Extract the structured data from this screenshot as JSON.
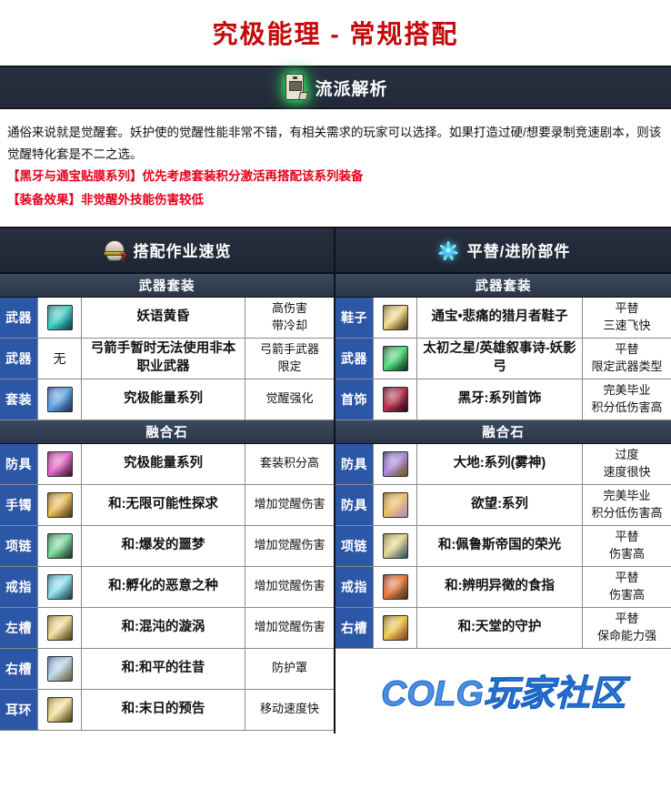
{
  "page": {
    "title": "究极能理 - 常规搭配",
    "title_color": "#c20a0a",
    "watermark": "COLG玩家社区",
    "footer_logo": "COLG玩家社区"
  },
  "analysis_section": {
    "icon": "scroll-document-icon",
    "header_label": "流派解析",
    "paragraph": "通俗来说就是觉醒套。妖护使的觉醒性能非常不错，有相关需求的玩家可以选择。如果打造过硬/想要录制竞速剧本，则该觉醒特化套是不二之选。",
    "notes": [
      "【黑牙与通宝贴膜系列】优先考虑套装积分激活再搭配该系列装备",
      "【装备效果】非觉醒外技能伤害较低"
    ],
    "note_color": "#e4001b"
  },
  "left_panel": {
    "icon": "helmet-question-icon",
    "header_label": "搭配作业速览",
    "groups": [
      {
        "group_label": "武器套装",
        "rows": [
          {
            "slot": "武器",
            "icon": "item-icon-weapon-teal",
            "icon_text": "",
            "name": "妖语黄昏",
            "note": "高伤害\n带冷却"
          },
          {
            "slot": "武器",
            "icon": "",
            "icon_text": "无",
            "name": "弓箭手暂时无法使用非本职业武器",
            "note": "弓箭手武器\n限定"
          },
          {
            "slot": "套装",
            "icon": "item-icon-armor-blue",
            "icon_text": "",
            "name": "究极能量系列",
            "note": "觉醒强化"
          }
        ]
      },
      {
        "group_label": "融合石",
        "rows": [
          {
            "slot": "防具",
            "icon": "item-icon-pink-orb",
            "icon_text": "",
            "name": "究极能量系列",
            "note": "套装积分高"
          },
          {
            "slot": "手镯",
            "icon": "item-icon-gold-hand",
            "icon_text": "",
            "name": "和:无限可能性探求",
            "note": "增加觉醒伤害"
          },
          {
            "slot": "项链",
            "icon": "item-icon-green-claw",
            "icon_text": "",
            "name": "和:爆发的噩梦",
            "note": "增加觉醒伤害"
          },
          {
            "slot": "戒指",
            "icon": "item-icon-blue-sphere",
            "icon_text": "",
            "name": "和:孵化的恶意之种",
            "note": "增加觉醒伤害"
          },
          {
            "slot": "左槽",
            "icon": "item-icon-gold-swirl",
            "icon_text": "",
            "name": "和:混沌的漩涡",
            "note": "增加觉醒伤害"
          },
          {
            "slot": "右槽",
            "icon": "item-icon-blue-book",
            "icon_text": "",
            "name": "和:和平的往昔",
            "note": "防护罩"
          },
          {
            "slot": "耳环",
            "icon": "item-icon-yellow-scroll",
            "icon_text": "",
            "name": "和:末日的预告",
            "note": "移动速度快"
          }
        ]
      }
    ]
  },
  "right_panel": {
    "icon": "blue-swirl-icon",
    "header_label": "平替/进阶部件",
    "groups": [
      {
        "group_label": "武器套装",
        "rows": [
          {
            "slot": "鞋子",
            "icon": "item-icon-gold-boots",
            "icon_text": "",
            "name": "通宝•悲痛的猎月者鞋子",
            "note": "平替\n三速飞快"
          },
          {
            "slot": "武器",
            "icon": "item-icon-green-bow",
            "icon_text": "",
            "name": "太初之星/英雄叙事诗-妖影弓",
            "note": "平替\n限定武器类型"
          },
          {
            "slot": "首饰",
            "icon": "item-icon-dark-red",
            "icon_text": "",
            "name": "黑牙:系列首饰",
            "note": "完美毕业\n积分低伤害高"
          }
        ]
      },
      {
        "group_label": "融合石",
        "rows": [
          {
            "slot": "防具",
            "icon": "item-icon-purple-figure",
            "icon_text": "",
            "name": "大地:系列(雾神)",
            "note": "过度\n速度很快"
          },
          {
            "slot": "防具",
            "icon": "item-icon-gold-figure",
            "icon_text": "",
            "name": "欲望:系列",
            "note": "完美毕业\n积分低伤害高"
          },
          {
            "slot": "项链",
            "icon": "item-icon-gold-spiral",
            "icon_text": "",
            "name": "和:佩鲁斯帝国的荣光",
            "note": "平替\n伤害高"
          },
          {
            "slot": "戒指",
            "icon": "item-icon-red-hand",
            "icon_text": "",
            "name": "和:辨明异徵的食指",
            "note": "平替\n伤害高"
          },
          {
            "slot": "右槽",
            "icon": "item-icon-gold-shield",
            "icon_text": "",
            "name": "和:天堂的守护",
            "note": "平替\n保命能力强"
          }
        ]
      }
    ]
  },
  "colors": {
    "accent_red": "#c20a0a",
    "slot_blue": "#2c56a6",
    "dark_header": "#242b3a",
    "sub_header": "#36435a",
    "logo_blue": "#4a8fe0"
  }
}
